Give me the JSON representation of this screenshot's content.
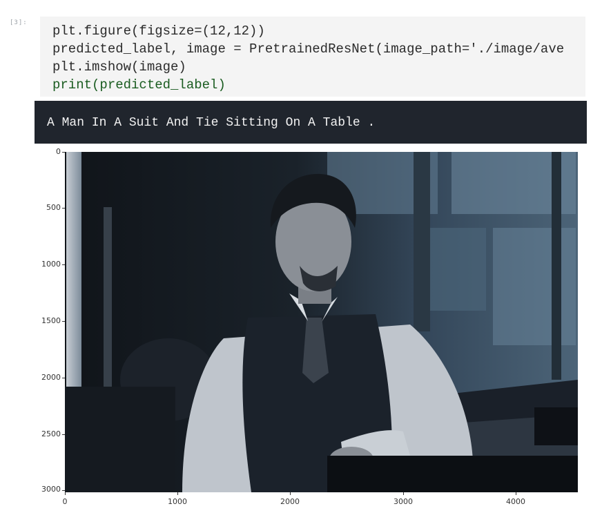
{
  "notebook": {
    "cell_prompt": "[3]:",
    "code_lines": [
      "plt.figure(figsize=(12,12))",
      "predicted_label, image = PretrainedResNet(image_path='./image/ave",
      "plt.imshow(image)",
      "print(predicted_label)"
    ],
    "output_text": "A Man In A Suit And Tie Sitting On A Table ."
  },
  "plot": {
    "y_ticks": [
      "0",
      "500",
      "1000",
      "1500",
      "2000",
      "2500",
      "3000"
    ],
    "x_ticks": [
      "0",
      "1000",
      "2000",
      "3000",
      "4000"
    ],
    "image_subject": "man in vest, white shirt and tie sitting at a table (movie still)"
  },
  "chart_data": {
    "type": "image",
    "xlim": [
      0,
      4550
    ],
    "ylim": [
      3020,
      0
    ],
    "x_ticks": [
      0,
      1000,
      2000,
      3000,
      4000
    ],
    "y_ticks": [
      0,
      500,
      1000,
      1500,
      2000,
      2500,
      3000
    ]
  }
}
